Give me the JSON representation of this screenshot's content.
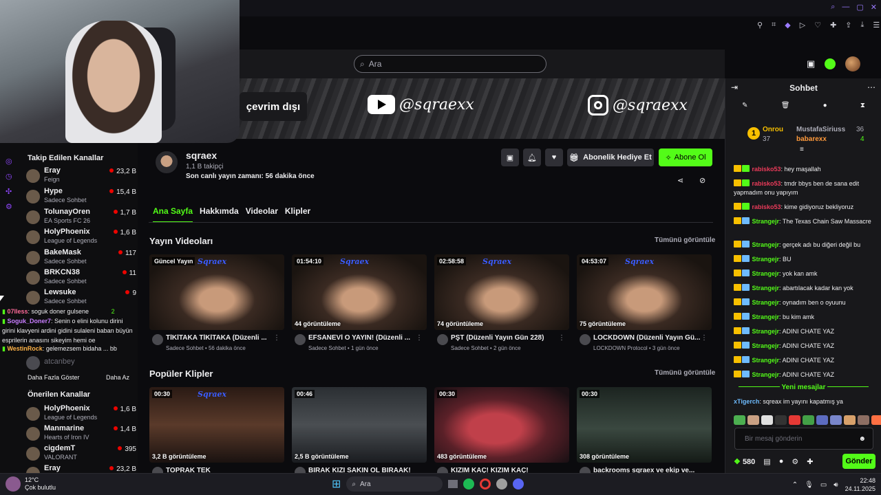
{
  "search": {
    "placeholder": "Ara"
  },
  "banner": {
    "offline": "çevrim dışı",
    "youtube": "@sqraexx",
    "instagram": "@sqraexx"
  },
  "channel": {
    "name": "sqraex",
    "followers": "1,1 B takipçi",
    "last_live": "Son canlı yayın zamanı: 56 dakika önce",
    "gift_sub": "Abonelik Hediye Et",
    "subscribe": "Abone Ol"
  },
  "tabs": [
    "Ana Sayfa",
    "Hakkımda",
    "Videolar",
    "Klipler"
  ],
  "sections": {
    "videos_title": "Yayın Videoları",
    "clips_title": "Popüler Klipler",
    "see_all": "Tümünü görüntüle"
  },
  "videos": [
    {
      "duration": "Güncel Yayın",
      "views": "",
      "title": "TİKİTAKA TİKİTAKA (Düzenli ...",
      "sub": "Sadece Sohbet • 56 dakika önce"
    },
    {
      "duration": "01:54:10",
      "views": "44 görüntüleme",
      "title": "EFSANEVİ O YAYIN! (Düzenli ...",
      "sub": "Sadece Sohbet • 1 gün önce"
    },
    {
      "duration": "02:58:58",
      "views": "74 görüntüleme",
      "title": "PŞT (Düzenli Yayın Gün 228)",
      "sub": "Sadece Sohbet • 2 gün önce"
    },
    {
      "duration": "04:53:07",
      "views": "75 görüntüleme",
      "title": "LOCKDOWN (Düzenli Yayın Gü...",
      "sub": "LOCKDOWN Protocol • 3 gün önce"
    }
  ],
  "clips": [
    {
      "duration": "00:30",
      "views": "3,2 B görüntüleme",
      "title": "TOPRAK TEK"
    },
    {
      "duration": "00:46",
      "views": "2,5 B görüntüleme",
      "title": "BIRAK KIZI SAKIN OL BIRAAK!"
    },
    {
      "duration": "00:30",
      "views": "483 görüntüleme",
      "title": "KIZIM KAÇ! KIZIM KAÇ!"
    },
    {
      "duration": "00:30",
      "views": "308 görüntüleme",
      "title": "backrooms sqraex ve ekip ve..."
    }
  ],
  "sidebar": {
    "followed_title": "Takip Edilen Kanallar",
    "followed": [
      {
        "name": "Eray",
        "game": "Feign",
        "viewers": "23,2 B"
      },
      {
        "name": "Hype",
        "game": "Sadece Sohbet",
        "viewers": "15,4 B"
      },
      {
        "name": "TolunayOren",
        "game": "EA Sports FC 26",
        "viewers": "1,7 B"
      },
      {
        "name": "HolyPhoenix",
        "game": "League of Legends",
        "viewers": "1,6 B"
      },
      {
        "name": "BakeMask",
        "game": "Sadece Sohbet",
        "viewers": "117"
      },
      {
        "name": "BRKCN38",
        "game": "Sadece Sohbet",
        "viewers": "11"
      },
      {
        "name": "Lewsuke",
        "game": "Sadece Sohbet",
        "viewers": "9"
      }
    ],
    "offline": [
      {
        "name": "atcanbey"
      }
    ],
    "show_more": "Daha Fazla Göster",
    "show_less": "Daha Az",
    "recommended_title": "Önerilen Kanallar",
    "recommended": [
      {
        "name": "HolyPhoenix",
        "game": "League of Legends",
        "viewers": "1,6 B"
      },
      {
        "name": "Manmarine",
        "game": "Hearts of Iron IV",
        "viewers": "1,4 B"
      },
      {
        "name": "cigdemT",
        "game": "VALORANT",
        "viewers": "395"
      },
      {
        "name": "Eray",
        "game": "",
        "viewers": "23,2 B"
      }
    ]
  },
  "overlay_chat": [
    {
      "user": "07lless",
      "text": ": soguk doner gulsene",
      "count": "2"
    },
    {
      "user": "Soguk_Doner7",
      "text": ": Senin o elini kolunu dirini girini klavyeni ardini gidini sulaleni baban büyün esprilerin anasını sikeyim hemi oe"
    },
    {
      "user": "WestinRock",
      "text": ": gelemezsem bidaha ... bb"
    }
  ],
  "chat": {
    "title": "Sohbet",
    "gifters": [
      {
        "name": "Onrou",
        "count": "37"
      },
      {
        "name": "MustafaSiriuss",
        "count": "36"
      },
      {
        "name": "babarexx",
        "count": "4"
      }
    ],
    "messages": [
      {
        "user": "rabisko53",
        "color": "red",
        "text": ": hey maşallah"
      },
      {
        "user": "rabisko53",
        "color": "red",
        "text": ": tmdr bbys ben de sana edit yapmadım onu yapıyım"
      },
      {
        "user": "rabisko53",
        "color": "red",
        "text": ": kime gidiyoruz bekliyoruz"
      },
      {
        "user": "Strangejr",
        "color": "green",
        "text": ": The Texas Chain Saw Massacre"
      },
      {
        "user": "Strangejr",
        "color": "green",
        "text": ": gerçek adı bu diğeri değil bu"
      },
      {
        "user": "Strangejr",
        "color": "green",
        "text": ": BU"
      },
      {
        "user": "Strangejr",
        "color": "green",
        "text": ": yok kan amk"
      },
      {
        "user": "Strangejr",
        "color": "green",
        "text": ": abartılacak kadar kan yok"
      },
      {
        "user": "Strangejr",
        "color": "green",
        "text": ": oynadım ben o oyuunu"
      },
      {
        "user": "Strangejr",
        "color": "green",
        "text": ": bu kim amk"
      },
      {
        "user": "Strangejr",
        "color": "green",
        "text": ": ADINI CHATE YAZ"
      },
      {
        "user": "Strangejr",
        "color": "green",
        "text": ": ADINI CHATE YAZ"
      },
      {
        "user": "Strangejr",
        "color": "green",
        "text": ": ADINI CHATE YAZ"
      },
      {
        "user": "Strangejr",
        "color": "green",
        "text": ": ADINI CHATE YAZ"
      }
    ],
    "new_messages": "Yeni mesajlar",
    "last_msg_user": "xTigerch",
    "last_msg_text": ": sqreax im yayını kapatmış ya",
    "input_placeholder": "Bir mesaj gönderin",
    "points": "580",
    "send": "Gönder"
  },
  "taskbar": {
    "temp": "12°C",
    "weather": "Çok bulutlu",
    "search": "Ara",
    "time": "22:48",
    "date": "24.11.2025"
  },
  "colors": {
    "accent": "#53fc18",
    "live": "#eb0400"
  }
}
